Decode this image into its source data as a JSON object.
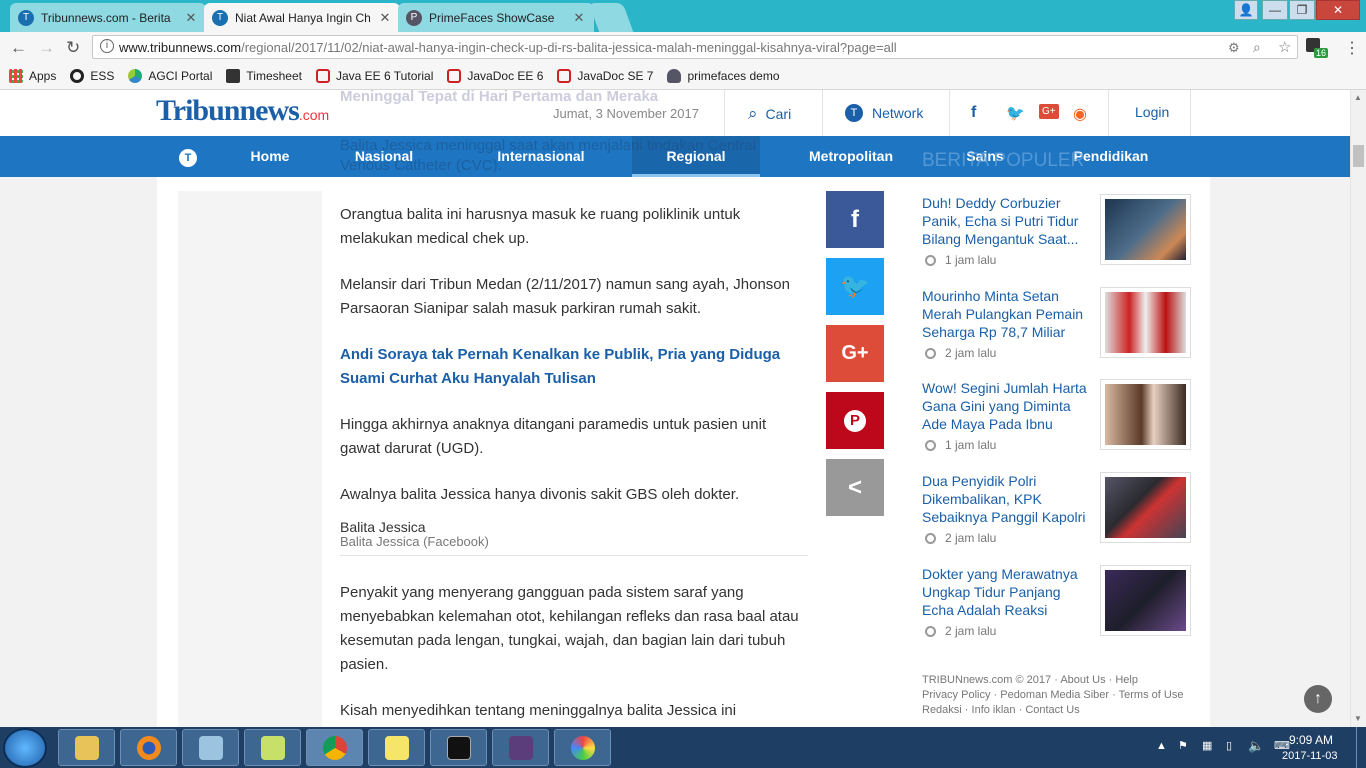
{
  "browser": {
    "tabs": [
      {
        "label": "Tribunnews.com - Berita"
      },
      {
        "label": "Niat Awal Hanya Ingin Ch"
      },
      {
        "label": "PrimeFaces ShowCase"
      }
    ],
    "url_host": "www.tribunnews.com",
    "url_path": "/regional/2017/11/02/niat-awal-hanya-ingin-check-up-di-rs-balita-jessica-malah-meninggal-kisahnya-viral?page=all",
    "extension_badge": "16",
    "bookmarks": [
      {
        "label": "Apps"
      },
      {
        "label": "ESS"
      },
      {
        "label": "AGCI Portal"
      },
      {
        "label": "Timesheet"
      },
      {
        "label": "Java EE 6 Tutorial"
      },
      {
        "label": "JavaDoc EE 6"
      },
      {
        "label": "JavaDoc SE 7"
      },
      {
        "label": "primefaces demo"
      }
    ]
  },
  "site": {
    "logo_main": "Tribunnews",
    "logo_suffix": ".com",
    "date": "Jumat, 3 November 2017",
    "search_label": "Cari",
    "network_label": "Network",
    "login_label": "Login",
    "menu": [
      {
        "label": "Home"
      },
      {
        "label": "Nasional"
      },
      {
        "label": "Internasional"
      },
      {
        "label": "Regional"
      },
      {
        "label": "Metropolitan"
      },
      {
        "label": "Sains"
      },
      {
        "label": "Pendidikan"
      }
    ],
    "ghost_heading": "Meninggal Tepat di Hari Pertama dan Meraka",
    "ghost_para": "Balita Jessica meninggal saat akan menjalani tindakan Central Venous Catheter (CVC).",
    "ghost_popular": "BERITA POPULER"
  },
  "article": {
    "p1": "Orangtua balita ini harusnya masuk ke ruang poliklinik untuk melakukan medical chek up.",
    "p2": "Melansir dari Tribun Medan (2/11/2017) namun sang ayah, Jhonson Parsaoran Sianipar salah masuk parkiran rumah sakit.",
    "related_link": "Andi Soraya tak Pernah Kenalkan ke Publik, Pria yang Diduga Suami Curhat Aku Hanyalah Tulisan",
    "p3": "Hingga akhirnya anaknya ditangani paramedis untuk pasien unit gawat darurat (UGD).",
    "p4": "Awalnya balita Jessica hanya divonis sakit GBS oleh dokter.",
    "caption_title": "Balita Jessica",
    "caption_source": "Balita Jessica (Facebook)",
    "p5": "Penyakit yang menyerang gangguan pada sistem saraf yang menyebabkan kelemahan otot, kehilangan refleks dan rasa baal atau kesemutan pada lengan, tungkai, wajah, dan bagian lain dari tubuh pasien.",
    "p6": "Kisah menyedihkan tentang meninggalnya balita Jessica ini"
  },
  "share": [
    {
      "glyph": "f",
      "color": "#3b5998"
    },
    {
      "glyph": "🐦",
      "color": "#1da1f2"
    },
    {
      "glyph": "G+",
      "color": "#dd4b39"
    },
    {
      "glyph": "P",
      "color": "#bd081c"
    },
    {
      "glyph": "<",
      "color": "#999999"
    }
  ],
  "sidebar": {
    "items": [
      {
        "title": "Duh! Deddy Corbuzier Panik, Echa si Putri Tidur Bilang Mengantuk Saat...",
        "time": "1 jam lalu"
      },
      {
        "title": "Mourinho Minta Setan Merah Pulangkan Pemain Seharga Rp 78,7 Miliar",
        "time": "2 jam lalu"
      },
      {
        "title": "Wow! Segini Jumlah Harta Gana Gini yang Diminta Ade Maya Pada Ibnu",
        "time": "1 jam lalu"
      },
      {
        "title": "Dua Penyidik Polri Dikembalikan, KPK Sebaiknya Panggil Kapolri",
        "time": "2 jam lalu"
      },
      {
        "title": "Dokter yang Merawatnya Ungkap Tidur Panjang Echa Adalah Reaksi",
        "time": "2 jam lalu"
      }
    ],
    "footer_line1": "TRIBUNnews.com © 2017  ·  About Us  ·  Help",
    "footer_line2": "Privacy Policy  ·  Pedoman Media Siber  ·  Terms of Use",
    "footer_line3": "Redaksi  ·  Info iklan  ·  Contact Us"
  },
  "taskbar": {
    "time": "9:09 AM",
    "date": "2017-11-03"
  }
}
